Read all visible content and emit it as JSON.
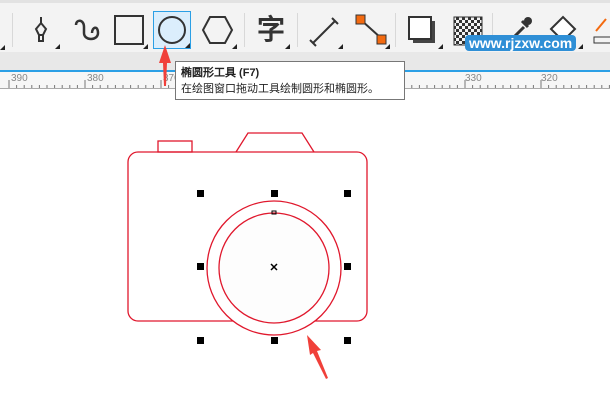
{
  "toolbar": {
    "tools": [
      {
        "name": "pen-tool",
        "active": false
      },
      {
        "name": "bspline-tool",
        "active": false
      },
      {
        "name": "rectangle-tool",
        "active": false
      },
      {
        "name": "ellipse-tool",
        "active": true
      },
      {
        "name": "polygon-tool",
        "active": false
      },
      {
        "name": "text-tool",
        "glyph": "字",
        "active": false
      },
      {
        "name": "dimension-tool",
        "active": false
      },
      {
        "name": "connector-tool",
        "active": false
      },
      {
        "name": "drop-shadow-tool",
        "active": false
      },
      {
        "name": "transparency-tool",
        "active": false
      },
      {
        "name": "eyedropper-tool",
        "active": false
      },
      {
        "name": "fill-tool",
        "active": false
      }
    ]
  },
  "ruler": {
    "labels": [
      "390",
      "380",
      "370",
      "330",
      "320"
    ]
  },
  "tooltip": {
    "title": "椭圆形工具 (F7)",
    "description": "在绘图窗口拖动工具绘制圆形和椭圆形。"
  },
  "watermark": "www.rjzxw.com",
  "colors": {
    "accent": "#2b9fe5",
    "shape_stroke": "#e0182d",
    "arrow": "#f0403a"
  }
}
